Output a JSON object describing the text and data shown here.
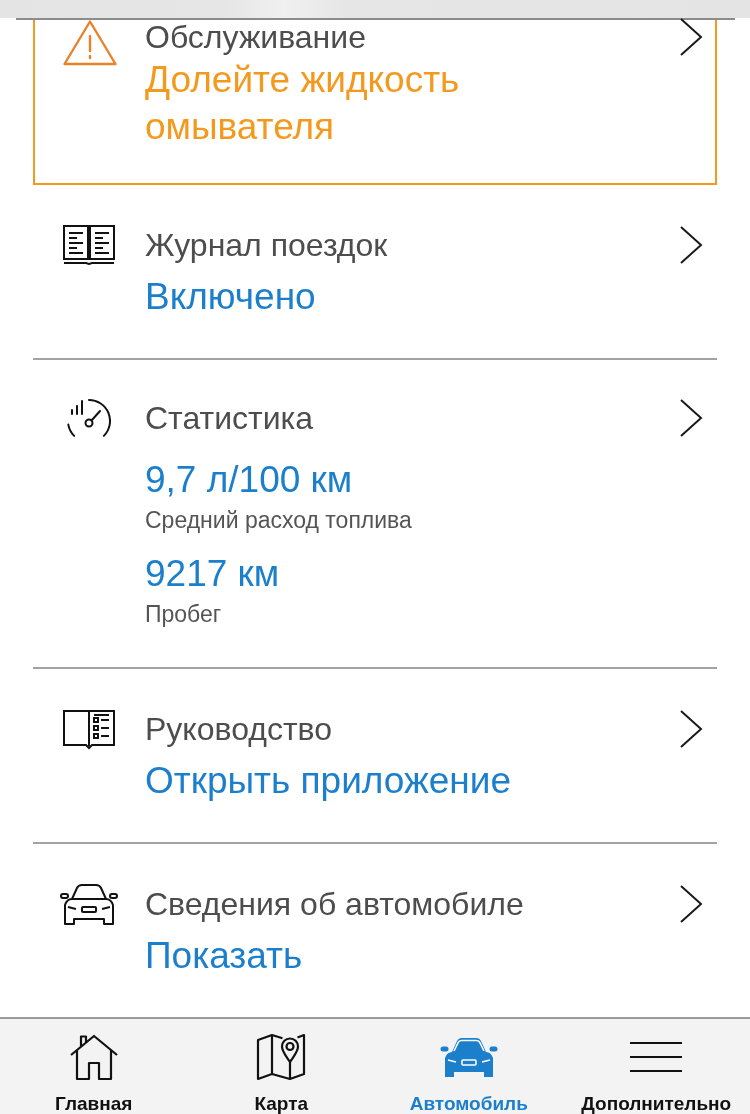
{
  "items": [
    {
      "kind": "alert",
      "title": "Обслуживание",
      "value": "Долейте жидкость омывателя"
    },
    {
      "kind": "nav",
      "title": "Журнал поездок",
      "value": "Включено"
    },
    {
      "kind": "stats",
      "title": "Статистика",
      "stats": [
        {
          "value": "9,7 л/100 км",
          "label": "Средний расход топлива"
        },
        {
          "value": "9217 км",
          "label": "Пробег"
        }
      ]
    },
    {
      "kind": "nav",
      "title": "Руководство",
      "value": "Открыть приложение"
    },
    {
      "kind": "nav",
      "title": "Сведения об автомобиле",
      "value": "Показать"
    }
  ],
  "tab_bar": {
    "tabs": [
      {
        "label": "Главная",
        "selected": false
      },
      {
        "label": "Карта",
        "selected": false
      },
      {
        "label": "Автомобиль",
        "selected": true
      },
      {
        "label": "Дополнительно",
        "selected": false
      }
    ]
  }
}
